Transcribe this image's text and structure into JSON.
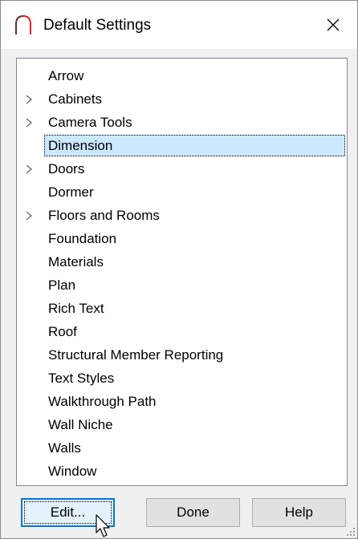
{
  "window": {
    "title": "Default Settings",
    "app_icon": "arch-icon",
    "close_icon": "close-icon",
    "accent": "#0078d7",
    "selection_color": "#cce8ff",
    "app_icon_color": "#e0242b"
  },
  "tree": {
    "items": [
      {
        "label": "Arrow",
        "expandable": false,
        "selected": false
      },
      {
        "label": "Cabinets",
        "expandable": true,
        "selected": false
      },
      {
        "label": "Camera Tools",
        "expandable": true,
        "selected": false
      },
      {
        "label": "Dimension",
        "expandable": false,
        "selected": true
      },
      {
        "label": "Doors",
        "expandable": true,
        "selected": false
      },
      {
        "label": "Dormer",
        "expandable": false,
        "selected": false
      },
      {
        "label": "Floors and Rooms",
        "expandable": true,
        "selected": false
      },
      {
        "label": "Foundation",
        "expandable": false,
        "selected": false
      },
      {
        "label": "Materials",
        "expandable": false,
        "selected": false
      },
      {
        "label": "Plan",
        "expandable": false,
        "selected": false
      },
      {
        "label": "Rich Text",
        "expandable": false,
        "selected": false
      },
      {
        "label": "Roof",
        "expandable": false,
        "selected": false
      },
      {
        "label": "Structural Member Reporting",
        "expandable": false,
        "selected": false
      },
      {
        "label": "Text Styles",
        "expandable": false,
        "selected": false
      },
      {
        "label": "Walkthrough Path",
        "expandable": false,
        "selected": false
      },
      {
        "label": "Wall Niche",
        "expandable": false,
        "selected": false
      },
      {
        "label": "Walls",
        "expandable": false,
        "selected": false
      },
      {
        "label": "Window",
        "expandable": false,
        "selected": false
      }
    ]
  },
  "buttons": {
    "edit_label": "Edit...",
    "done_label": "Done",
    "help_label": "Help"
  }
}
